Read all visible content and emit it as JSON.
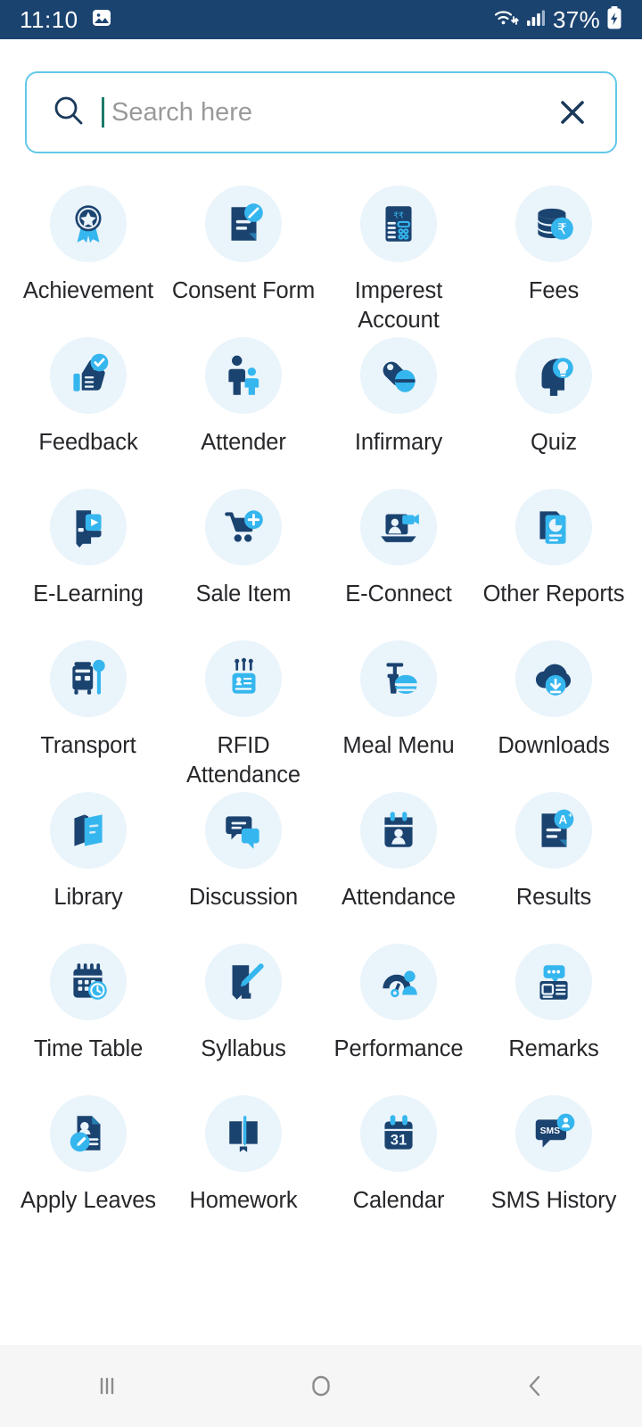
{
  "status_bar": {
    "time": "11:10",
    "battery_text": "37%",
    "icons": [
      "gallery-icon",
      "wifi-icon",
      "cellular-signal-icon",
      "battery-charging-icon"
    ],
    "background_color": "#1b4370"
  },
  "search": {
    "value": "",
    "placeholder": "Search here",
    "search_icon": "search-icon",
    "clear_icon": "close-icon",
    "border_color": "#63c8e8"
  },
  "theme": {
    "icon_circle_bg": "#eaf4fb",
    "icon_dark": "#1b4370",
    "icon_light": "#35b6ee",
    "label_color": "#27272b"
  },
  "grid": {
    "columns": 4,
    "items": [
      {
        "label": "Achievement",
        "icon": "award-medal-icon"
      },
      {
        "label": "Consent Form",
        "icon": "document-edit-icon"
      },
      {
        "label": "Imperest Account",
        "icon": "calculator-rupee-icon"
      },
      {
        "label": "Fees",
        "icon": "coins-rupee-icon"
      },
      {
        "label": "Feedback",
        "icon": "thumbs-up-check-icon"
      },
      {
        "label": "Attender",
        "icon": "parent-child-icon"
      },
      {
        "label": "Infirmary",
        "icon": "pills-icon"
      },
      {
        "label": "Quiz",
        "icon": "head-lightbulb-icon"
      },
      {
        "label": "E-Learning",
        "icon": "book-play-icon"
      },
      {
        "label": "Sale Item",
        "icon": "cart-plus-icon"
      },
      {
        "label": "E-Connect",
        "icon": "laptop-video-icon"
      },
      {
        "label": "Other Reports",
        "icon": "report-chart-icon"
      },
      {
        "label": "Transport",
        "icon": "bus-stop-icon"
      },
      {
        "label": "RFID Attendance",
        "icon": "rfid-card-icon"
      },
      {
        "label": "Meal Menu",
        "icon": "meal-drink-icon"
      },
      {
        "label": "Downloads",
        "icon": "cloud-download-icon"
      },
      {
        "label": "Library",
        "icon": "books-icon"
      },
      {
        "label": "Discussion",
        "icon": "chat-bubbles-icon"
      },
      {
        "label": "Attendance",
        "icon": "calendar-person-icon"
      },
      {
        "label": "Results",
        "icon": "document-grade-icon"
      },
      {
        "label": "Time Table",
        "icon": "calendar-clock-icon"
      },
      {
        "label": "Syllabus",
        "icon": "book-pencil-icon"
      },
      {
        "label": "Performance",
        "icon": "gauge-person-icon"
      },
      {
        "label": "Remarks",
        "icon": "remark-card-icon"
      },
      {
        "label": "Apply Leaves",
        "icon": "id-card-edit-icon"
      },
      {
        "label": "Homework",
        "icon": "open-book-pencil-icon"
      },
      {
        "label": "Calendar",
        "icon": "calendar-31-icon"
      },
      {
        "label": "SMS History",
        "icon": "sms-bubble-icon"
      }
    ],
    "calendar_day": "31",
    "sms_label": "SMS",
    "grade_label": "A"
  },
  "nav_bar": {
    "recents_label": "recents-button",
    "home_label": "home-button",
    "back_label": "back-button"
  }
}
